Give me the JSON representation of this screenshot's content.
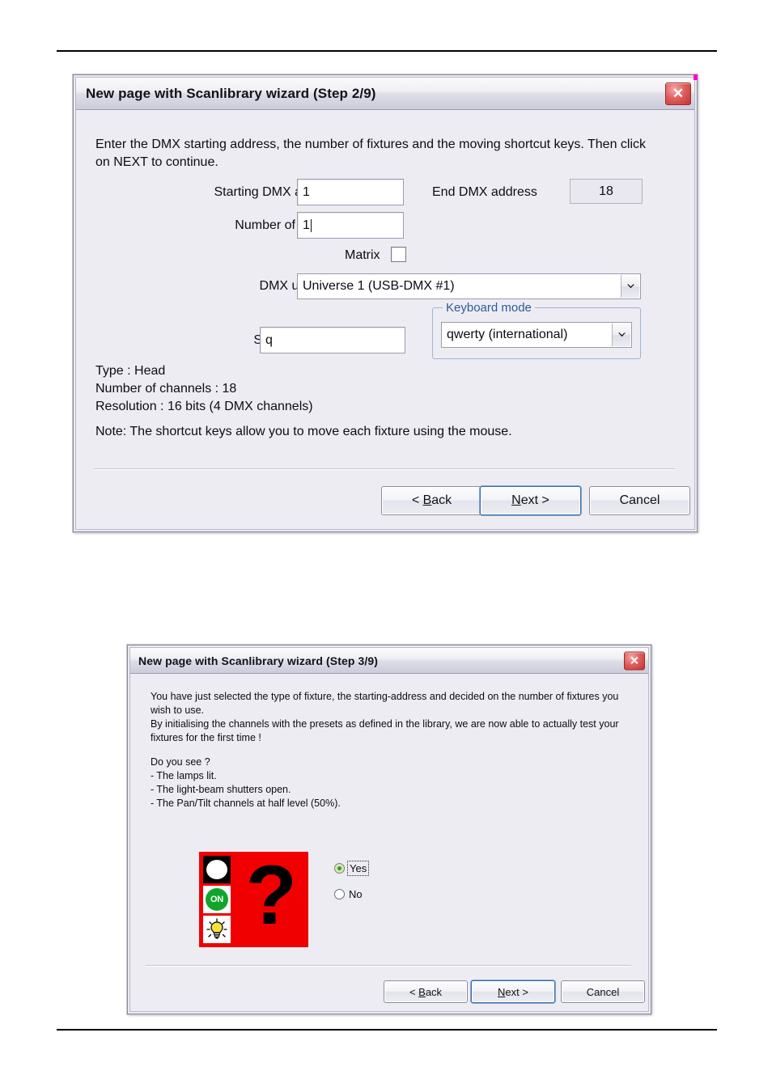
{
  "page": {
    "background": "#ffffff",
    "rule_color": "#000000"
  },
  "dialog1": {
    "title": "New page with Scanlibrary wizard (Step 2/9)",
    "close_icon_label": "✕",
    "intro_text": "Enter the DMX starting address, the number of fixtures and the moving shortcut keys. Then click on NEXT to continue.",
    "fields": {
      "starting_dmx_address": {
        "label": "Starting DMX address",
        "value": "1",
        "placeholder": ""
      },
      "end_dmx_address": {
        "label": "End DMX address",
        "value": "18"
      },
      "number_of_fixtures": {
        "label": "Number of fixtures",
        "value": "1",
        "placeholder": ""
      },
      "matrix": {
        "label": "Matrix",
        "checked": false
      },
      "dmx_universe": {
        "label": "DMX universe",
        "value": "Universe  1    (USB-DMX #1)"
      },
      "shortcuts": {
        "label": "Shortcuts",
        "value": "q",
        "placeholder": ""
      }
    },
    "keyboard_mode": {
      "group_title": "Keyboard mode",
      "value": "qwerty (international)"
    },
    "info_lines": "Type : Head\nNumber of channels : 18\nResolution : 16 bits (4 DMX channels)",
    "note": "Note: The shortcut keys allow you to move each fixture using the mouse.",
    "buttons": {
      "back_prefix": "< ",
      "back_accel": "B",
      "back_suffix": "ack",
      "next_accel": "N",
      "next_suffix": "ext >",
      "cancel": "Cancel"
    }
  },
  "dialog2": {
    "title": "New page with Scanlibrary wizard (Step 3/9)",
    "close_icon_label": "✕",
    "paragraph1": "You have just selected the type of fixture, the starting-address and decided on the number of fixtures you wish to use.\nBy initialising the channels with the presets as defined in the library, we are now able to actually test your fixtures for the first time !",
    "paragraph2": "Do you see ?\n- The lamps lit.\n- The light-beam shutters open.\n- The Pan/Tilt channels at half level (50%).",
    "picture": {
      "background_color": "#f00000",
      "question_mark": "?",
      "on_badge_text": "ON"
    },
    "radios": [
      {
        "label": "Yes",
        "checked": true,
        "focused": true
      },
      {
        "label": "No",
        "checked": false,
        "focused": false
      }
    ],
    "buttons": {
      "back_prefix": "< ",
      "back_accel": "B",
      "back_suffix": "ack",
      "next_accel": "N",
      "next_suffix": "ext >",
      "cancel": "Cancel"
    }
  }
}
